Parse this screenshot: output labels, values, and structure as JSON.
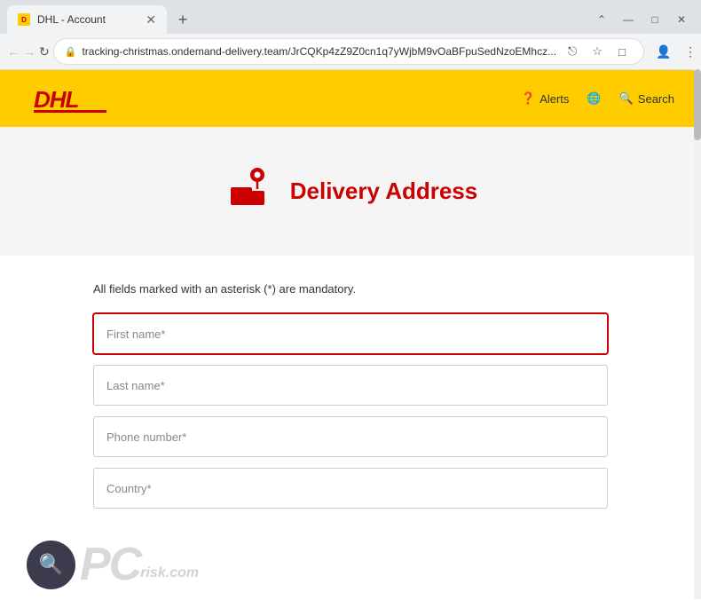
{
  "browser": {
    "tab_title": "DHL - Account",
    "tab_favicon": "DHL",
    "new_tab_icon": "+",
    "window_controls": {
      "minimize": "—",
      "maximize": "□",
      "close": "✕"
    },
    "nav": {
      "back_disabled": true,
      "forward_disabled": true,
      "refresh": "↻"
    },
    "address": {
      "url": "tracking-christmas.ondemand-delivery.team/JrCQKp4zZ9Z0cn1q7yWjbM9vOaBFpuSedNzoEMhcz...",
      "lock_icon": "🔒"
    },
    "address_bar_icons": {
      "share": "⎋",
      "bookmark": "☆",
      "profile": "□",
      "person": "👤",
      "menu": "⋮"
    }
  },
  "header": {
    "logo_text": "DHL",
    "nav_items": [
      {
        "icon": "❓",
        "label": "Alerts"
      },
      {
        "icon": "🌐",
        "label": ""
      },
      {
        "icon": "🔍",
        "label": "Search"
      }
    ],
    "alerts_label": "Alerts",
    "search_label": "Search"
  },
  "hero": {
    "title": "Delivery Address",
    "delivery_icon": "📦"
  },
  "form": {
    "mandatory_note": "All fields marked with an asterisk (*) are mandatory.",
    "fields": [
      {
        "label": "First name*",
        "placeholder": "First name*",
        "type": "text",
        "active": true
      },
      {
        "label": "Last name*",
        "placeholder": "Last name*",
        "type": "text",
        "active": false
      },
      {
        "label": "Phone number*",
        "placeholder": "Phone number*",
        "type": "tel",
        "active": false
      },
      {
        "label": "Country*",
        "placeholder": "Country*",
        "type": "text",
        "active": false
      }
    ]
  },
  "watermark": {
    "text": "PC",
    "domain": "risk.com"
  }
}
